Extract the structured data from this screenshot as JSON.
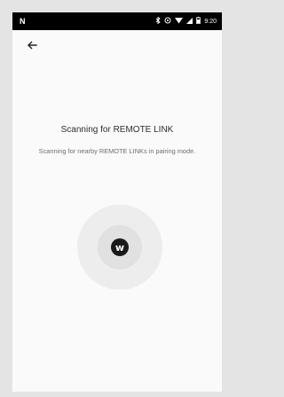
{
  "status_bar": {
    "left_logo": "N",
    "time": "9:20",
    "icons": [
      "bluetooth-icon",
      "sync-icon",
      "wifi-icon",
      "signal-icon",
      "battery-icon"
    ]
  },
  "nav": {
    "back_icon": "arrow-left-icon"
  },
  "main": {
    "title": "Scanning for REMOTE LINK",
    "subtitle": "Scanning for nearby REMOTE LINKs in pairing mode."
  },
  "indicator": {
    "logo_text": "w",
    "colors": {
      "outer": "#ededed",
      "inner": "#e1e1e1",
      "logo": "#1a1a1a"
    }
  }
}
